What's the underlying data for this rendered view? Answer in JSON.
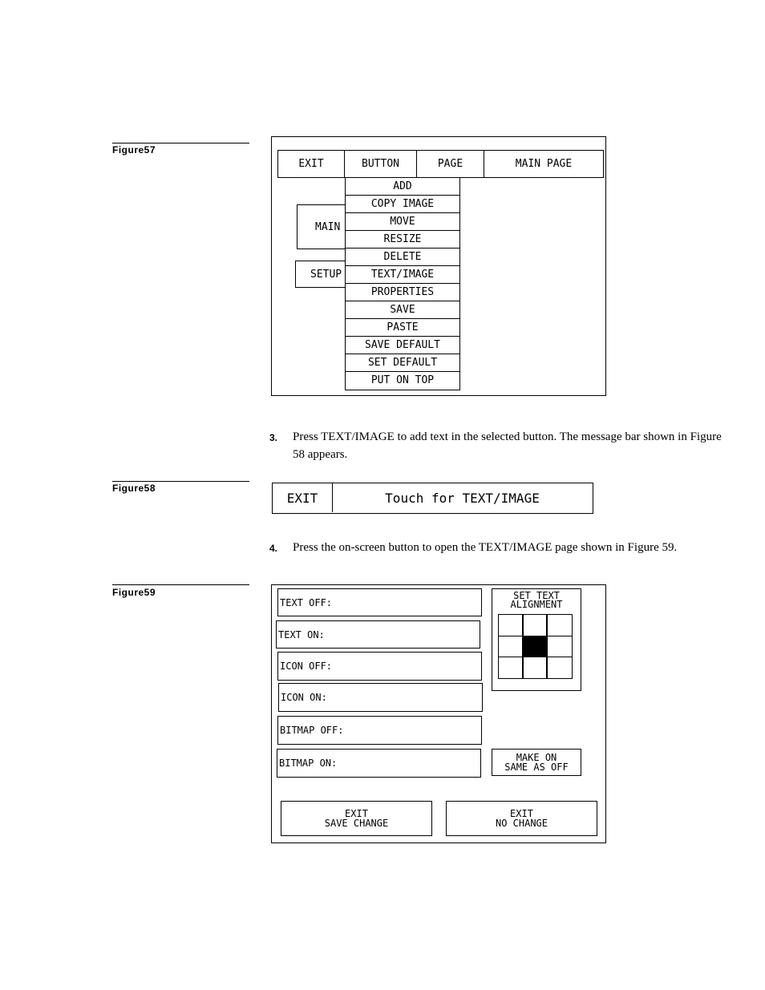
{
  "figures": {
    "fig57": "Figure57",
    "fig58": "Figure58",
    "fig59": "Figure59"
  },
  "fig57": {
    "menubar": [
      "EXIT",
      "BUTTON",
      "PAGE",
      "MAIN PAGE"
    ],
    "dropdown": [
      "ADD",
      "COPY IMAGE",
      "MOVE",
      "RESIZE",
      "DELETE",
      "TEXT/IMAGE",
      "PROPERTIES",
      "SAVE",
      "PASTE",
      "SAVE DEFAULT",
      "SET DEFAULT",
      "PUT ON TOP"
    ],
    "bg_buttons": [
      "MAIN",
      "SETUP"
    ]
  },
  "steps": [
    {
      "num": "3.",
      "text": "Press TEXT/IMAGE to add text in the selected button. The message bar shown in Figure 58 appears."
    },
    {
      "num": "4.",
      "text": "Press the on-screen button to open the TEXT/IMAGE page shown in Figure 59."
    }
  ],
  "fig58": {
    "exit": "EXIT",
    "message": "Touch for TEXT/IMAGE"
  },
  "fig59": {
    "fields": [
      "TEXT OFF:",
      "TEXT ON:",
      "ICON OFF:",
      "ICON ON:",
      "BITMAP OFF:",
      "BITMAP ON:"
    ],
    "alignment": {
      "title1": "SET TEXT",
      "title2": "ALIGNMENT",
      "selected": "center"
    },
    "make_on": {
      "l1": "MAKE ON",
      "l2": "SAME AS OFF"
    },
    "exit_save": {
      "l1": "EXIT",
      "l2": "SAVE CHANGE"
    },
    "exit_no": {
      "l1": "EXIT",
      "l2": "NO CHANGE"
    }
  }
}
